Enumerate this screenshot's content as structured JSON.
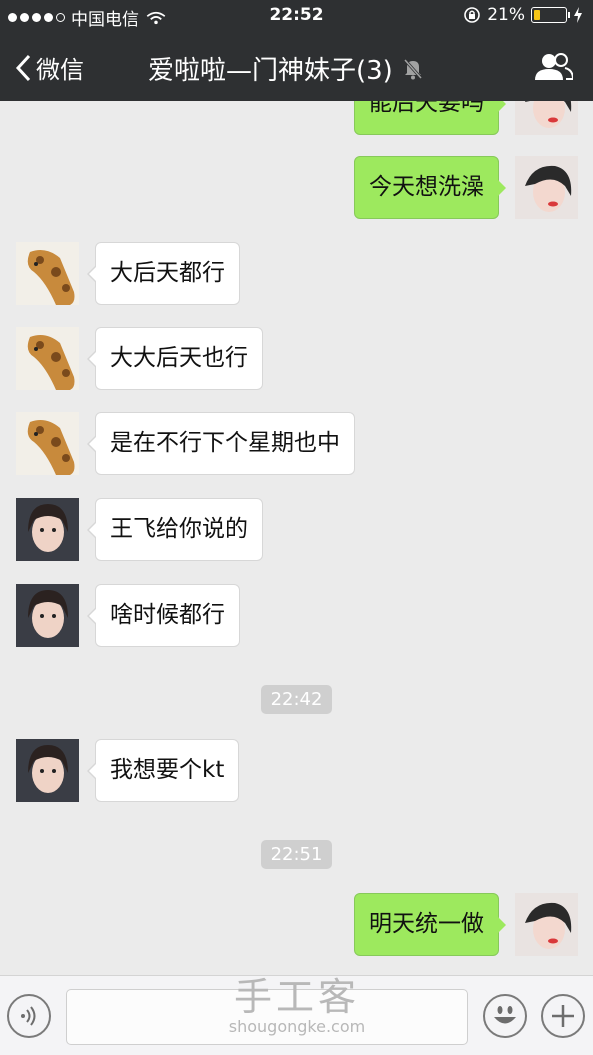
{
  "status_bar": {
    "carrier": "中国电信",
    "time": "22:52",
    "battery_percent": "21%",
    "battery_level": 0.21,
    "battery_color": "#f5c518"
  },
  "nav": {
    "back_label": "微信",
    "title": "爱啦啦—门神妹子(3)",
    "mute_icon": "bell-mute-icon",
    "members_icon": "people-icon"
  },
  "messages": [
    {
      "sender": "self",
      "text": "能后天要吗"
    },
    {
      "sender": "self",
      "text": "今天想洗澡"
    },
    {
      "sender": "giraffe",
      "text": "大后天都行"
    },
    {
      "sender": "giraffe",
      "text": "大大后天也行"
    },
    {
      "sender": "giraffe",
      "text": "是在不行下个星期也中"
    },
    {
      "sender": "girl",
      "text": "王飞给你说的"
    },
    {
      "sender": "girl",
      "text": "啥时候都行"
    },
    {
      "sender": "girl",
      "text": "我想要个kt"
    },
    {
      "sender": "self",
      "text": "明天统一做"
    }
  ],
  "timestamps": [
    "22:42",
    "22:51"
  ],
  "input_bar": {
    "voice_icon": "voice-icon",
    "emoji_icon": "emoji-icon",
    "plus_icon": "plus-icon"
  },
  "watermark": {
    "cn": "手工客",
    "en": "shougongke.com"
  },
  "colors": {
    "nav_bg": "#2e3032",
    "out_bubble": "#9de95e",
    "in_bubble": "#ffffff",
    "chat_bg": "#ebebeb"
  }
}
